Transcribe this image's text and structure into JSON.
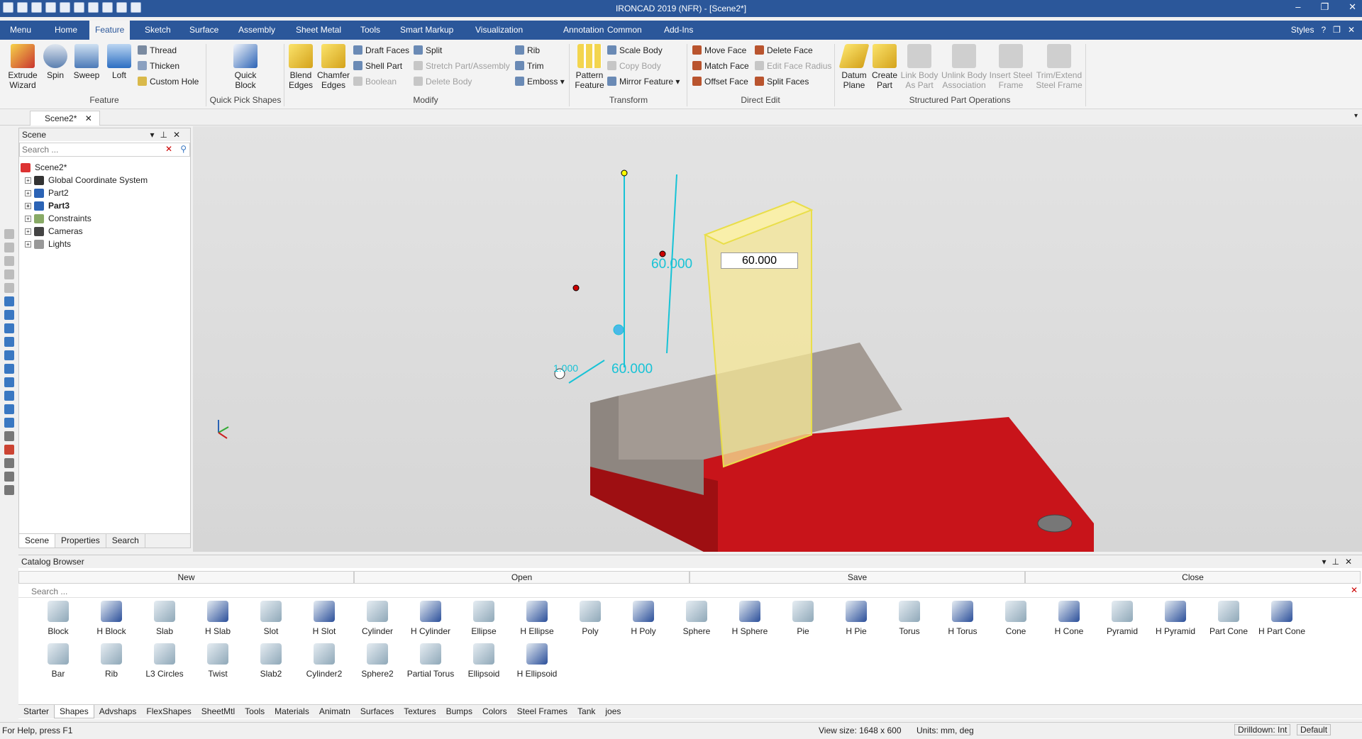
{
  "title": "IRONCAD 2019 (NFR) - [Scene2*]",
  "menu_tabs": [
    "Menu",
    "Home",
    "Feature",
    "Sketch",
    "Surface",
    "Assembly",
    "Sheet Metal",
    "Tools",
    "Smart Markup",
    "Visualization",
    "Annotation",
    "Common",
    "Add-Ins"
  ],
  "active_menu": "Feature",
  "styles_label": "Styles",
  "ribbon": {
    "extrude": "Extrude\nWizard",
    "spin": "Spin",
    "sweep": "Sweep",
    "loft": "Loft",
    "thread": "Thread",
    "thicken": "Thicken",
    "custom_hole": "Custom Hole",
    "group_feature": "Feature",
    "quick_block": "Quick\nBlock",
    "group_quick": "Quick Pick Shapes",
    "blend_edges": "Blend\nEdges",
    "chamfer_edges": "Chamfer\nEdges",
    "draft_faces": "Draft Faces",
    "shell_part": "Shell Part",
    "boolean": "Boolean",
    "split": "Split",
    "stretch_part": "Stretch Part/Assembly",
    "delete_body": "Delete Body",
    "rib": "Rib",
    "trim": "Trim",
    "emboss": "Emboss",
    "group_modify": "Modify",
    "pattern_feature": "Pattern\nFeature",
    "scale_body": "Scale Body",
    "copy_body": "Copy Body",
    "mirror_feature": "Mirror Feature",
    "group_transform": "Transform",
    "move_face": "Move Face",
    "match_face": "Match Face",
    "offset_face": "Offset Face",
    "delete_face": "Delete Face",
    "edit_face_radius": "Edit Face Radius",
    "split_faces": "Split Faces",
    "group_direct": "Direct Edit",
    "datum_plane": "Datum\nPlane",
    "create_part": "Create\nPart",
    "link_body": "Link Body\nAs Part",
    "unlink_body": "Unlink Body\nAssociation",
    "insert_steel": "Insert Steel\nFrame",
    "trim_extend": "Trim/Extend\nSteel Frame",
    "group_structured": "Structured Part Operations"
  },
  "doc_tab": "Scene2*",
  "scene": {
    "title": "Scene",
    "search_placeholder": "Search ...",
    "root": "Scene2*",
    "nodes": [
      "Global Coordinate System",
      "Part2",
      "Part3",
      "Constraints",
      "Cameras",
      "Lights"
    ],
    "tabs": [
      "Scene",
      "Properties",
      "Search"
    ]
  },
  "viewport": {
    "dim_input": "60.000",
    "dim_height": "60.000",
    "dim_width": "60.000",
    "dim_small": "1.000"
  },
  "catalog": {
    "title": "Catalog Browser",
    "new": "New",
    "open": "Open",
    "save": "Save",
    "close": "Close",
    "search_placeholder": "Search ...",
    "shapes_row1": [
      "Block",
      "H Block",
      "Slab",
      "H Slab",
      "Slot",
      "H Slot",
      "Cylinder",
      "H Cylinder",
      "Ellipse",
      "H Ellipse",
      "Poly",
      "H Poly",
      "Sphere",
      "H Sphere",
      "Pie",
      "H Pie",
      "Torus",
      "H Torus",
      "Cone",
      "H Cone",
      "Pyramid",
      "H Pyramid",
      "Part Cone",
      "H Part Cone"
    ],
    "shapes_row2": [
      "Bar",
      "Rib",
      "L3 Circles",
      "Twist",
      "Slab2",
      "Cylinder2",
      "Sphere2",
      "Partial Torus",
      "Ellipsoid",
      "H Ellipsoid"
    ],
    "tabs": [
      "Starter",
      "Shapes",
      "Advshaps",
      "FlexShapes",
      "SheetMtl",
      "Tools",
      "Materials",
      "Animatn",
      "Surfaces",
      "Textures",
      "Bumps",
      "Colors",
      "Steel Frames",
      "Tank",
      "joes"
    ],
    "active_tab": "Shapes"
  },
  "status": {
    "help": "For Help, press F1",
    "view_size": "View size: 1648 x  600",
    "units": "Units: mm, deg",
    "drilldown": "Drilldown: Int",
    "default": "Default"
  }
}
